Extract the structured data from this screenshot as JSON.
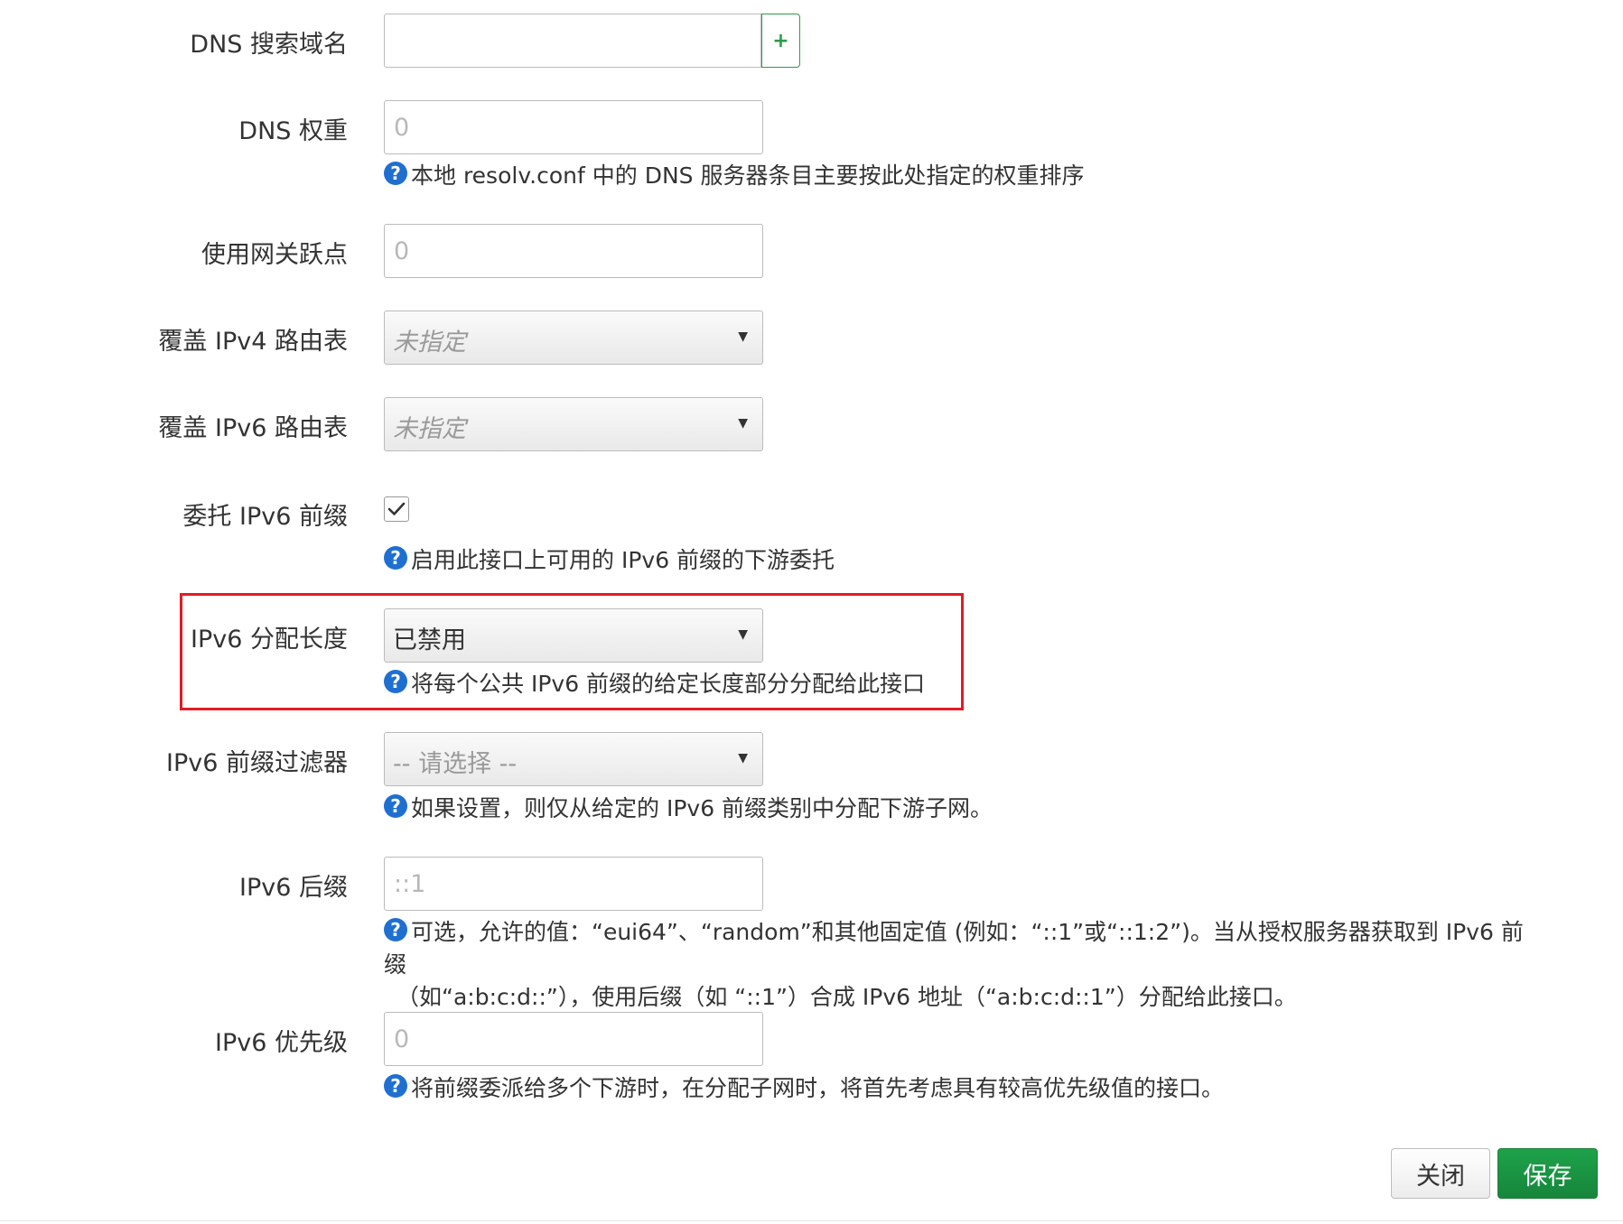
{
  "fields": {
    "dns_search": {
      "label": "DNS 搜索域名",
      "value": "",
      "add_label": "+"
    },
    "dns_weight": {
      "label": "DNS 权重",
      "placeholder": "0",
      "help": "本地 resolv.conf 中的 DNS 服务器条目主要按此处指定的权重排序"
    },
    "gateway_metric": {
      "label": "使用网关跃点",
      "placeholder": "0"
    },
    "ipv4_table": {
      "label": "覆盖 IPv4 路由表",
      "selected": "未指定"
    },
    "ipv6_table": {
      "label": "覆盖 IPv6 路由表",
      "selected": "未指定"
    },
    "delegate": {
      "label": "委托 IPv6 前缀",
      "checked": true,
      "help": "启用此接口上可用的 IPv6 前缀的下游委托"
    },
    "ip6assign": {
      "label": "IPv6 分配长度",
      "selected": "已禁用",
      "help": "将每个公共 IPv6 前缀的给定长度部分分配给此接口"
    },
    "ip6class": {
      "label": "IPv6 前缀过滤器",
      "selected": "-- 请选择 --",
      "help": "如果设置，则仅从给定的 IPv6 前缀类别中分配下游子网。"
    },
    "ip6ifaceid": {
      "label": "IPv6 后缀",
      "placeholder": "::1",
      "help_line1": "可选，允许的值：“eui64”、“random”和其他固定值 (例如：“::1”或“::1:2”)。当从授权服务器获取到 IPv6 前缀",
      "help_line2": "（如“a:b:c:d::”），使用后缀（如 “::1”）合成 IPv6 地址（“a:b:c:d::1”）分配给此接口。"
    },
    "ip6weight": {
      "label": "IPv6 优先级",
      "placeholder": "0",
      "help": "将前缀委派给多个下游时，在分配子网时，将首先考虑具有较高优先级值的接口。"
    }
  },
  "buttons": {
    "close": "关闭",
    "save": "保存"
  },
  "icons": {
    "help": "question-circle-icon",
    "dropdown": "caret-down-icon",
    "check": "checkmark-icon"
  },
  "colors": {
    "accent_green": "#2e9a4a",
    "help_blue": "#1f6fd1",
    "highlight_red": "#e31b23"
  }
}
